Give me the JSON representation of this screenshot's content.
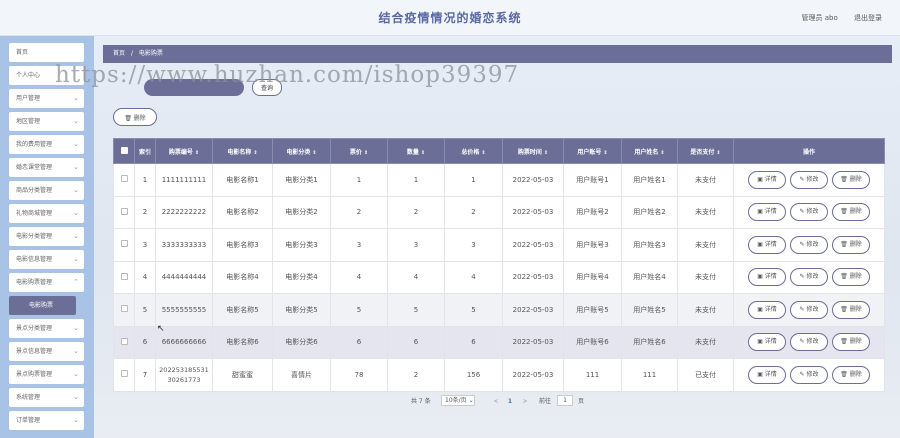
{
  "header": {
    "title": "结合疫情情况的婚恋系统",
    "admin_label": "管理员 abo",
    "logout_label": "退出登录"
  },
  "sidebar": {
    "items": [
      {
        "label": "首页"
      },
      {
        "label": "个人中心"
      },
      {
        "label": "用户管理"
      },
      {
        "label": "地区管理"
      },
      {
        "label": "我的费用管理"
      },
      {
        "label": "婚恋课堂管理"
      },
      {
        "label": "商品分类管理"
      },
      {
        "label": "礼物商城管理"
      },
      {
        "label": "电影分类管理"
      },
      {
        "label": "电影信息管理"
      },
      {
        "label": "电影购票管理"
      },
      {
        "label": "电影购票"
      },
      {
        "label": "景点分类管理"
      },
      {
        "label": "景点信息管理"
      },
      {
        "label": "景点购票管理"
      },
      {
        "label": "系统管理"
      },
      {
        "label": "订单管理"
      }
    ]
  },
  "breadcrumb": {
    "home": "首页",
    "separator": "/",
    "current": "电影购票"
  },
  "watermark": "https://www.huzhan.com/ishop39397",
  "search": {
    "placeholder": "",
    "button_label": "查询"
  },
  "delete_button_label": "删除",
  "table": {
    "headers": [
      "索引",
      "购票编号",
      "电影名称",
      "电影分类",
      "票价",
      "数量",
      "总价格",
      "购票时间",
      "用户账号",
      "用户姓名",
      "是否支付",
      "操作"
    ],
    "rows": [
      {
        "index": "1",
        "ticket_no": "1111111111",
        "movie_name": "电影名称1",
        "movie_category": "电影分类1",
        "price": "1",
        "quantity": "1",
        "total": "1",
        "purchase_time": "2022-05-03",
        "user_account": "用户账号1",
        "user_name": "用户姓名1",
        "paid": "未支付"
      },
      {
        "index": "2",
        "ticket_no": "2222222222",
        "movie_name": "电影名称2",
        "movie_category": "电影分类2",
        "price": "2",
        "quantity": "2",
        "total": "2",
        "purchase_time": "2022-05-03",
        "user_account": "用户账号2",
        "user_name": "用户姓名2",
        "paid": "未支付"
      },
      {
        "index": "3",
        "ticket_no": "3333333333",
        "movie_name": "电影名称3",
        "movie_category": "电影分类3",
        "price": "3",
        "quantity": "3",
        "total": "3",
        "purchase_time": "2022-05-03",
        "user_account": "用户账号3",
        "user_name": "用户姓名3",
        "paid": "未支付"
      },
      {
        "index": "4",
        "ticket_no": "4444444444",
        "movie_name": "电影名称4",
        "movie_category": "电影分类4",
        "price": "4",
        "quantity": "4",
        "total": "4",
        "purchase_time": "2022-05-03",
        "user_account": "用户账号4",
        "user_name": "用户姓名4",
        "paid": "未支付"
      },
      {
        "index": "5",
        "ticket_no": "5555555555",
        "movie_name": "电影名称5",
        "movie_category": "电影分类5",
        "price": "5",
        "quantity": "5",
        "total": "5",
        "purchase_time": "2022-05-03",
        "user_account": "用户账号5",
        "user_name": "用户姓名5",
        "paid": "未支付"
      },
      {
        "index": "6",
        "ticket_no": "6666666666",
        "movie_name": "电影名称6",
        "movie_category": "电影分类6",
        "price": "6",
        "quantity": "6",
        "total": "6",
        "purchase_time": "2022-05-03",
        "user_account": "用户账号6",
        "user_name": "用户姓名6",
        "paid": "未支付"
      },
      {
        "index": "7",
        "ticket_no": "20225318553130261773",
        "movie_name": "甜蜜蜜",
        "movie_category": "喜情片",
        "price": "78",
        "quantity": "2",
        "total": "156",
        "purchase_time": "2022-05-03",
        "user_account": "111",
        "user_name": "111",
        "paid": "已支付"
      }
    ],
    "row_actions": {
      "detail": "详情",
      "edit": "修改",
      "delete": "删除"
    }
  },
  "pagination": {
    "total": "共 7 条",
    "page_size": "10条/页",
    "prev": "<",
    "current_page": "1",
    "next": ">",
    "goto_label": "前往",
    "goto_value": "1",
    "page_suffix": "页"
  }
}
